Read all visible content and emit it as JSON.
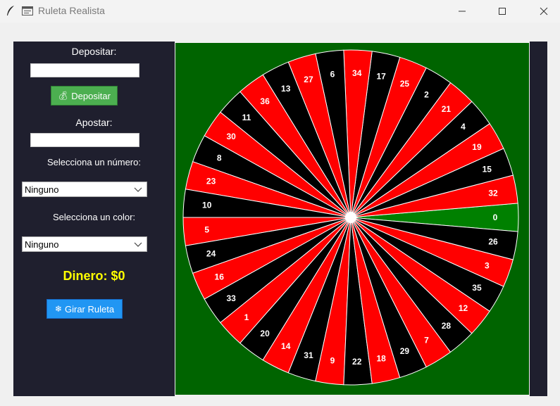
{
  "window": {
    "title": "Ruleta Realista",
    "app_icon": "feather-icon",
    "window_icon": "app-window-icon",
    "controls": [
      "minimize-icon",
      "maximize-icon",
      "close-icon"
    ]
  },
  "left_panel": {
    "deposit_label": "Depositar:",
    "deposit_value": "",
    "deposit_button": {
      "label": "Depositar",
      "icon": "money-bag-icon",
      "color": "#4caf50"
    },
    "bet_label": "Apostar:",
    "bet_value": "",
    "number_label": "Selecciona un número:",
    "number_selected": "Ninguno",
    "color_label": "Selecciona un color:",
    "color_selected": "Ninguno",
    "money_text": "Dinero: $0",
    "spin_button": {
      "label": "Girar Ruleta",
      "icon": "snowflake-icon",
      "color": "#2196f3"
    }
  },
  "wheel": {
    "numbers": [
      "0",
      "32",
      "15",
      "19",
      "4",
      "21",
      "2",
      "25",
      "17",
      "34",
      "6",
      "27",
      "13",
      "36",
      "11",
      "30",
      "8",
      "23",
      "10",
      "5",
      "24",
      "16",
      "33",
      "1",
      "20",
      "14",
      "31",
      "9",
      "22",
      "18",
      "29",
      "7",
      "28",
      "12",
      "35",
      "3",
      "26"
    ],
    "colors": {
      "red": "#ff0000",
      "black": "#000000",
      "green": "#008000",
      "table": "#006400"
    }
  }
}
